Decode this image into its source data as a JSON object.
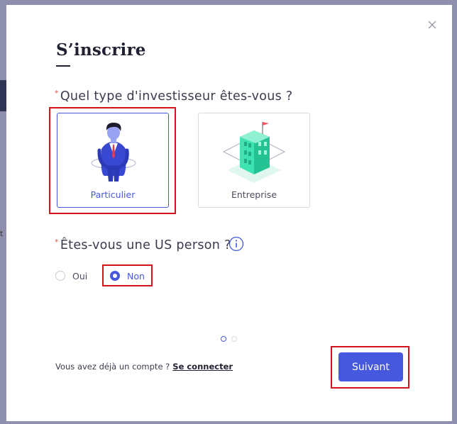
{
  "modal": {
    "title": "S’inscrire",
    "close_icon": "close-icon"
  },
  "investor_type": {
    "required_mark": "*",
    "question": "Quel type d'investisseur êtes-vous ?",
    "options": [
      {
        "label": "Particulier",
        "icon": "person-illustration",
        "selected": true
      },
      {
        "label": "Entreprise",
        "icon": "building-illustration",
        "selected": false
      }
    ]
  },
  "us_person": {
    "required_mark": "*",
    "question": "Êtes-vous une US person ?",
    "info_icon": "info-icon",
    "options": [
      {
        "label": "Oui",
        "checked": false
      },
      {
        "label": "Non",
        "checked": true
      }
    ]
  },
  "pager": {
    "total": 2,
    "current": 1
  },
  "footer": {
    "prompt": "Vous avez déjà un compte ?",
    "login_link": "Se connecter"
  },
  "next_button": {
    "label": "Suivant"
  },
  "colors": {
    "accent": "#4658de",
    "highlight": "#d4141b",
    "required": "#e4554b",
    "building": "#3ee3b2"
  }
}
